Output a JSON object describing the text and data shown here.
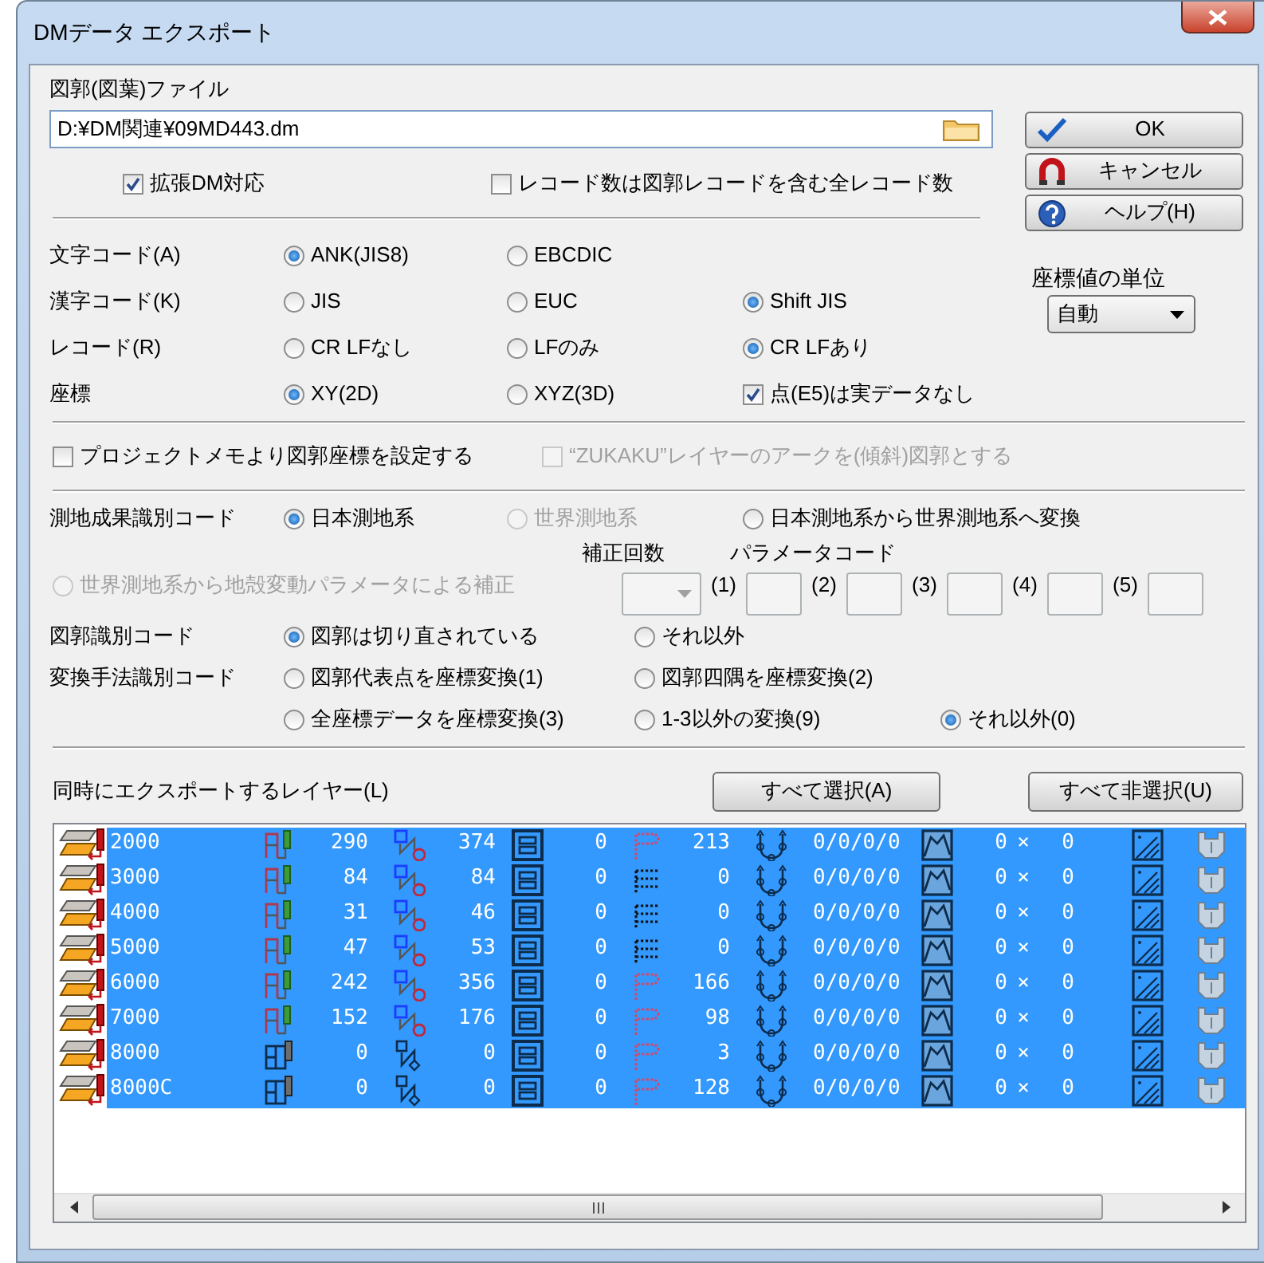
{
  "window": {
    "title": "DMデータ エクスポート"
  },
  "file": {
    "label": "図郭(図葉)ファイル",
    "value": "D:¥DM関連¥09MD443.dm"
  },
  "options_top": [
    {
      "label": "拡張DM対応",
      "checked": true
    },
    {
      "label": "レコード数は図郭レコードを含む全レコード数",
      "checked": false
    }
  ],
  "buttons": [
    {
      "kind": "ok",
      "label": "OK"
    },
    {
      "kind": "cancel",
      "label": "キャンセル"
    },
    {
      "kind": "help",
      "label": "ヘルプ(H)"
    }
  ],
  "unit": {
    "label": "座標値の単位",
    "value": "自動"
  },
  "code_rows": [
    {
      "label": "文字コード(A)",
      "options": [
        {
          "kind": "radio",
          "label": "ANK(JIS8)",
          "selected": true
        },
        {
          "kind": "radio",
          "label": "EBCDIC",
          "selected": false
        }
      ]
    },
    {
      "label": "漢字コード(K)",
      "options": [
        {
          "kind": "radio",
          "label": "JIS",
          "selected": false
        },
        {
          "kind": "radio",
          "label": "EUC",
          "selected": false
        },
        {
          "kind": "radio",
          "label": "Shift JIS",
          "selected": true
        }
      ]
    },
    {
      "label": "レコード(R)",
      "options": [
        {
          "kind": "radio",
          "label": "CR LFなし",
          "selected": false
        },
        {
          "kind": "radio",
          "label": "LFのみ",
          "selected": false
        },
        {
          "kind": "radio",
          "label": "CR LFあり",
          "selected": true
        }
      ]
    },
    {
      "label": "座標",
      "options": [
        {
          "kind": "radio",
          "label": "XY(2D)",
          "selected": true
        },
        {
          "kind": "radio",
          "label": "XYZ(3D)",
          "selected": false
        },
        {
          "kind": "checkbox",
          "label": "点(E5)は実データなし",
          "checked": true
        }
      ]
    }
  ],
  "options_mid": [
    {
      "label": "プロジェクトメモより図郭座標を設定する",
      "checked": false,
      "disabled": false
    },
    {
      "label": "“ZUKAKU”レイヤーのアークを(傾斜)図郭とする",
      "checked": false,
      "disabled": true
    }
  ],
  "geodetic": {
    "label": "測地成果識別コード",
    "options": [
      {
        "label": "日本測地系",
        "selected": true,
        "disabled": false
      },
      {
        "label": "世界測地系",
        "selected": false,
        "disabled": true
      },
      {
        "label": "日本測地系から世界測地系へ変換",
        "selected": false,
        "disabled": false
      }
    ]
  },
  "correction": {
    "option": {
      "label": "世界測地系から地殻変動パラメータによる補正",
      "selected": false,
      "disabled": true
    },
    "count_label": "補正回数",
    "count_field": {
      "disabled": true
    },
    "param_label": "パラメータコード",
    "params": [
      {
        "label": "(1)"
      },
      {
        "label": "(2)"
      },
      {
        "label": "(3)"
      },
      {
        "label": "(4)"
      },
      {
        "label": "(5)"
      }
    ]
  },
  "mesh": {
    "label": "図郭識別コード",
    "options": [
      {
        "label": "図郭は切り直されている",
        "selected": true
      },
      {
        "label": "それ以外",
        "selected": false
      }
    ]
  },
  "transform": {
    "label": "変換手法識別コード",
    "lines": [
      [
        {
          "label": "図郭代表点を座標変換(1)",
          "selected": false
        },
        {
          "label": "図郭四隅を座標変換(2)",
          "selected": false
        }
      ],
      [
        {
          "label": "全座標データを座標変換(3)",
          "selected": false
        },
        {
          "label": "1-3以外の変換(9)",
          "selected": false
        },
        {
          "label": "それ以外(0)",
          "selected": true
        }
      ]
    ]
  },
  "layers": {
    "label": "同時にエクスポートするレイヤー(L)",
    "buttons": [
      {
        "label": "すべて選択(A)"
      },
      {
        "label": "すべて非選択(U)"
      }
    ],
    "rows": [
      {
        "name": "2000",
        "text_icon": {
          "kind": "color"
        },
        "point_icon": {
          "kind": "red"
        },
        "text_count": "290",
        "line_count": "374",
        "area_count": "0",
        "point_count": "213",
        "curve_value": "0/0/0/0",
        "grid_count": "0",
        "grid_mark": "×",
        "grid_count2": "0",
        "selected": true
      },
      {
        "name": "3000",
        "text_icon": {
          "kind": "color"
        },
        "point_icon": {
          "kind": "dots"
        },
        "text_count": "84",
        "line_count": "84",
        "area_count": "0",
        "point_count": "0",
        "curve_value": "0/0/0/0",
        "grid_count": "0",
        "grid_mark": "×",
        "grid_count2": "0",
        "selected": true
      },
      {
        "name": "4000",
        "text_icon": {
          "kind": "color"
        },
        "point_icon": {
          "kind": "dots"
        },
        "text_count": "31",
        "line_count": "46",
        "area_count": "0",
        "point_count": "0",
        "curve_value": "0/0/0/0",
        "grid_count": "0",
        "grid_mark": "×",
        "grid_count2": "0",
        "selected": true
      },
      {
        "name": "5000",
        "text_icon": {
          "kind": "color"
        },
        "point_icon": {
          "kind": "dots"
        },
        "text_count": "47",
        "line_count": "53",
        "area_count": "0",
        "point_count": "0",
        "curve_value": "0/0/0/0",
        "grid_count": "0",
        "grid_mark": "×",
        "grid_count2": "0",
        "selected": true
      },
      {
        "name": "6000",
        "text_icon": {
          "kind": "color"
        },
        "point_icon": {
          "kind": "red"
        },
        "text_count": "242",
        "line_count": "356",
        "area_count": "0",
        "point_count": "166",
        "curve_value": "0/0/0/0",
        "grid_count": "0",
        "grid_mark": "×",
        "grid_count2": "0",
        "selected": true
      },
      {
        "name": "7000",
        "text_icon": {
          "kind": "color"
        },
        "point_icon": {
          "kind": "red"
        },
        "text_count": "152",
        "line_count": "176",
        "area_count": "0",
        "point_count": "98",
        "curve_value": "0/0/0/0",
        "grid_count": "0",
        "grid_mark": "×",
        "grid_count2": "0",
        "selected": true
      },
      {
        "name": "8000",
        "text_icon": {
          "kind": "dark"
        },
        "point_icon": {
          "kind": "red"
        },
        "text_count": "0",
        "line_count": "0",
        "area_count": "0",
        "point_count": "3",
        "curve_value": "0/0/0/0",
        "grid_count": "0",
        "grid_mark": "×",
        "grid_count2": "0",
        "selected": true
      },
      {
        "name": "8000C",
        "text_icon": {
          "kind": "dark"
        },
        "point_icon": {
          "kind": "red"
        },
        "text_count": "0",
        "line_count": "0",
        "area_count": "0",
        "point_count": "128",
        "curve_value": "0/0/0/0",
        "grid_count": "0",
        "grid_mark": "×",
        "grid_count2": "0",
        "selected": true
      }
    ]
  }
}
